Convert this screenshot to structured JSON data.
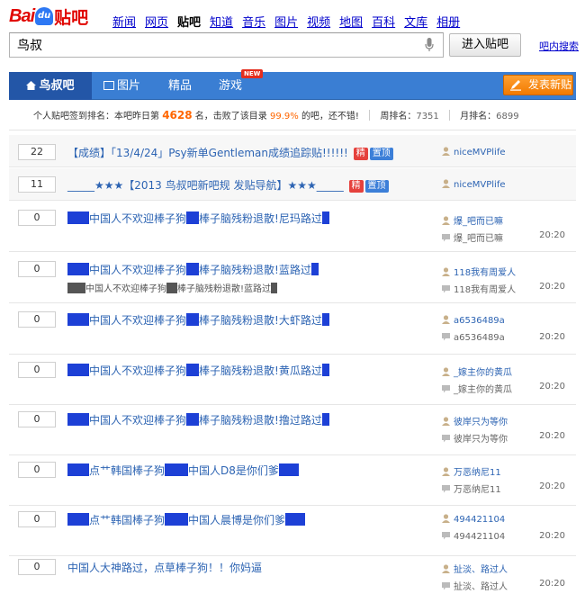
{
  "logo": {
    "bai": "Bai",
    "du": "du",
    "tieba": "贴吧"
  },
  "nav": [
    "新闻",
    "网页",
    "贴吧",
    "知道",
    "音乐",
    "图片",
    "视频",
    "地图",
    "百科",
    "文库",
    "相册"
  ],
  "search": {
    "value": "鸟叔",
    "button": "进入贴吧",
    "inner_search": "吧内搜索"
  },
  "tabs": {
    "home": "鸟叔吧",
    "pics": "图片",
    "good": "精品",
    "games": "游戏",
    "new_badge": "NEW",
    "post_button": "发表新贴"
  },
  "stats": {
    "prefix": "个人贴吧签到排名：本吧昨日第",
    "rank": "4628",
    "middle": "名，击败了该目录",
    "percent": "99.9%",
    "suffix": "的吧，还不错!",
    "week_label": "周排名：",
    "week_value": "7351",
    "month_label": "月排名：",
    "month_value": "6899"
  },
  "threads": [
    {
      "count": "22",
      "title": "【成绩】「13/4/24」Psy新单Gentleman成绩追踪贴!!!!!!",
      "tags": [
        "精",
        "置顶"
      ],
      "author": "niceMVPlife"
    },
    {
      "count": "11",
      "title": "_____★★★【2013 鸟叔吧新吧规 发贴导航】★★★_____",
      "tags": [
        "精",
        "置顶"
      ],
      "author": "niceMVPlife"
    },
    {
      "count": "0",
      "pre": "",
      "title": "中国人不欢迎棒子狗",
      "title2": "棒子脑残粉退散!",
      "title3": "尼玛路过",
      "author": "爆_吧而已嘛",
      "replier": "爆_吧而已嘛",
      "time": "20:20"
    },
    {
      "count": "0",
      "title": "中国人不欢迎棒子狗",
      "title2": "棒子脑残粉退散!",
      "title3": "蓝路过",
      "abstract1": "中国人不欢迎棒子狗",
      "abstract2": "棒子脑残粉退散!",
      "abstract3": "蓝路过",
      "author": "118我有周爱人",
      "replier": "118我有周爱人",
      "time": "20:20"
    },
    {
      "count": "0",
      "title": "中国人不欢迎棒子狗",
      "title2": "棒子脑残粉退散!",
      "title3": "大虾路过",
      "author": "a6536489a",
      "replier": "a6536489a",
      "time": "20:20"
    },
    {
      "count": "0",
      "title": "中国人不欢迎棒子狗",
      "title2": "棒子脑残粉退散!",
      "title3": "黄瓜路过",
      "author": "_嫁主你的黄瓜",
      "replier": "_嫁主你的黄瓜",
      "time": "20:20"
    },
    {
      "count": "0",
      "title": "中国人不欢迎棒子狗",
      "title2": "棒子脑残粉退散!",
      "title3": "撸过路过",
      "author": "彼岸只为等你",
      "replier": "彼岸只为等你",
      "time": "20:20"
    },
    {
      "count": "0",
      "title": "点艹韩国棒子狗",
      "title2": "中国人D8是你们爹",
      "author": "万恶纳尼11",
      "replier": "万恶纳尼11",
      "time": "20:20"
    },
    {
      "count": "0",
      "title": "点艹韩国棒子狗",
      "title2": "中国人晨博是你们爹",
      "author": "494421104",
      "replier": "494421104",
      "time": "20:20"
    },
    {
      "count": "0",
      "title": "中国人大神路过，点草棒子狗！！你妈逼",
      "author": "扯淡、路过人",
      "replier": "扯淡、路过人",
      "time": "20:20"
    }
  ]
}
